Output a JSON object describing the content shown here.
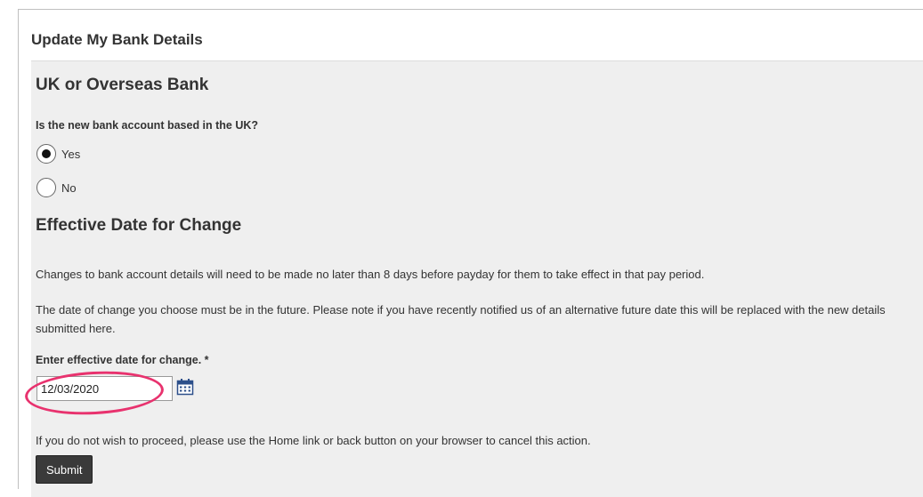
{
  "page": {
    "title": "Update My Bank Details"
  },
  "bank_section": {
    "heading": "UK or Overseas Bank",
    "question": "Is the new bank account based in the UK?",
    "options": [
      {
        "label": "Yes",
        "selected": true
      },
      {
        "label": "No",
        "selected": false
      }
    ]
  },
  "effective_section": {
    "heading": "Effective Date for Change",
    "paragraph_1": "Changes to bank account details will need to be made no later than 8 days before payday for them to take effect in that pay period.",
    "paragraph_2": "The date of change you choose must be in the future. Please note if you have recently notified us of an alternative future date this will be replaced with the new details submitted here.",
    "date_label": "Enter effective date for change. *",
    "date_value": "12/03/2020",
    "cancel_note": "If you do not wish to proceed, please use the Home link or back button on your browser to cancel this action.",
    "submit_label": "Submit"
  },
  "icons": {
    "calendar": "calendar-icon"
  },
  "colors": {
    "panel_bg": "#efefef",
    "highlight": "#e8326e",
    "button_bg": "#3a3a3a",
    "calendar_blue": "#2c4f8a"
  }
}
